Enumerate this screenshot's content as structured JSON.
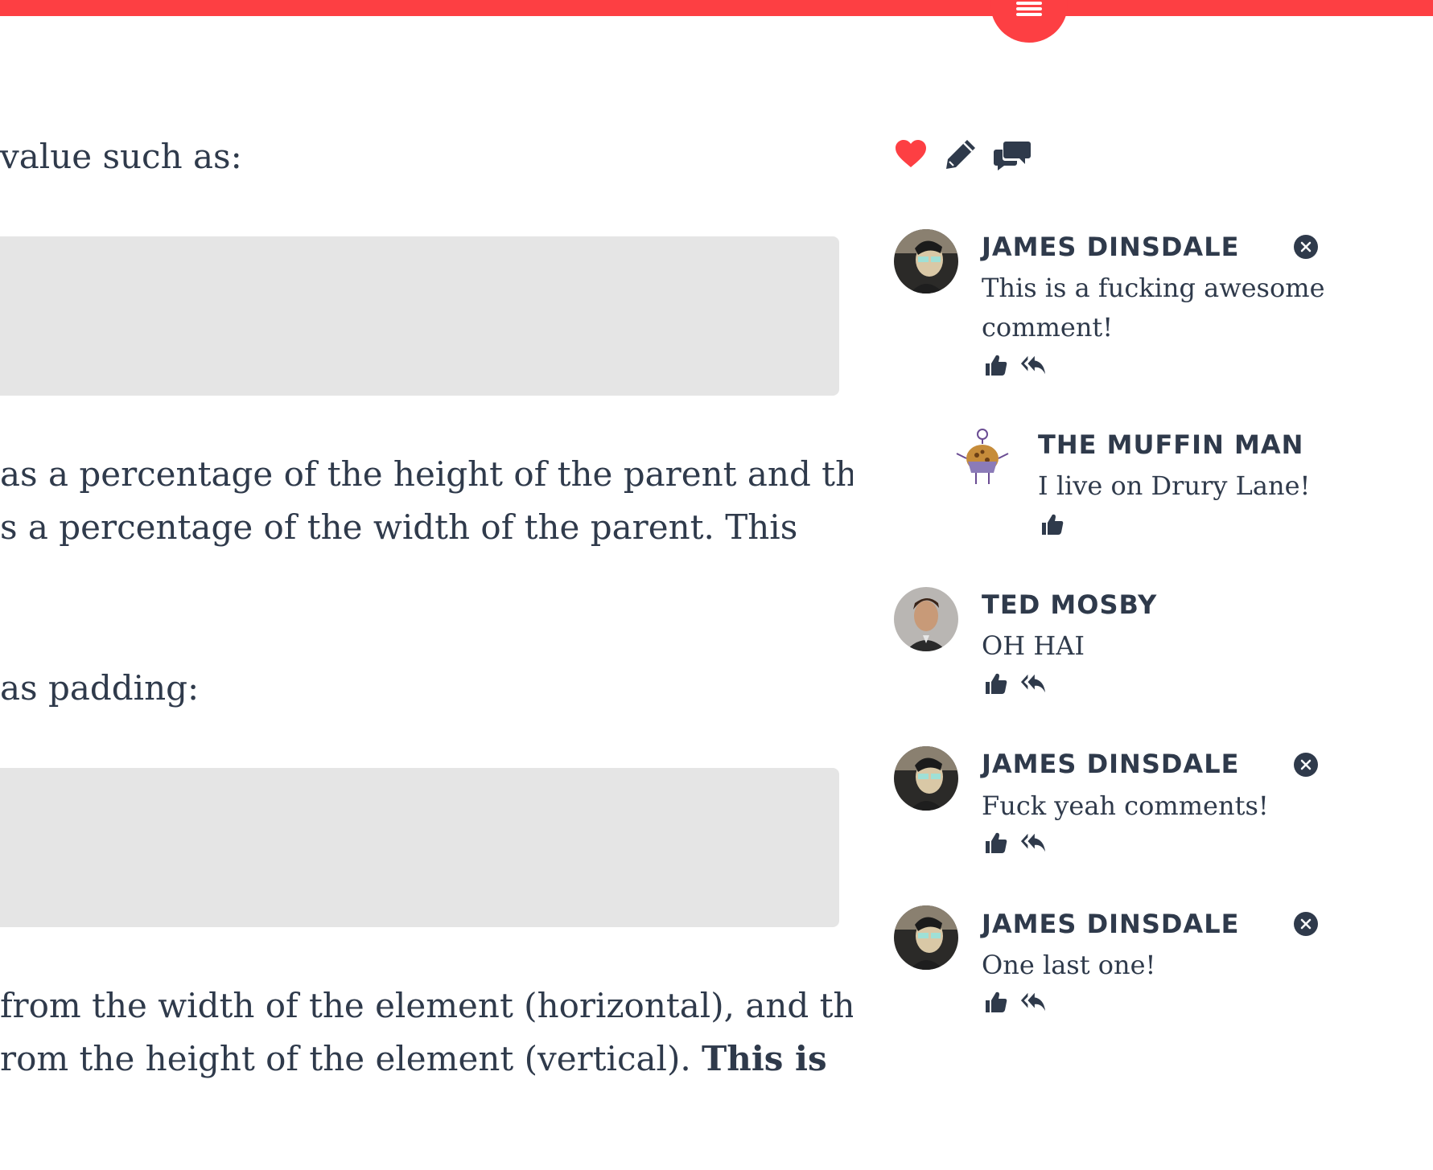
{
  "header": {
    "menu_icon": "hamburger-menu-icon",
    "accent_color": "#fd3f43"
  },
  "article": {
    "line1": "value such as:",
    "para2_line1": "as a percentage of the height of the parent and the",
    "para2_line2": "s a percentage of the width of the parent. This",
    "line3": "as padding:",
    "para4_line1": "from the width of the element (horizontal), and the",
    "para4_line2": "rom the height of the element (vertical). ",
    "para4_bold": "This is"
  },
  "actions": {
    "like_icon": "heart-icon",
    "edit_icon": "pencil-icon",
    "comments_icon": "comments-icon"
  },
  "comments": [
    {
      "author": "JAMES DINSDALE",
      "text": "This is a fucking awesome comment!",
      "deletable": true,
      "reply": true
    },
    {
      "author": "THE MUFFIN MAN",
      "text": "I live on Drury Lane!",
      "deletable": false,
      "reply": false
    },
    {
      "author": "TED MOSBY",
      "text": "OH HAI",
      "deletable": false,
      "reply": true
    },
    {
      "author": "JAMES DINSDALE",
      "text": "Fuck yeah comments!",
      "deletable": true,
      "reply": true
    },
    {
      "author": "JAMES DINSDALE",
      "text": "One last one!",
      "deletable": true,
      "reply": true
    }
  ]
}
